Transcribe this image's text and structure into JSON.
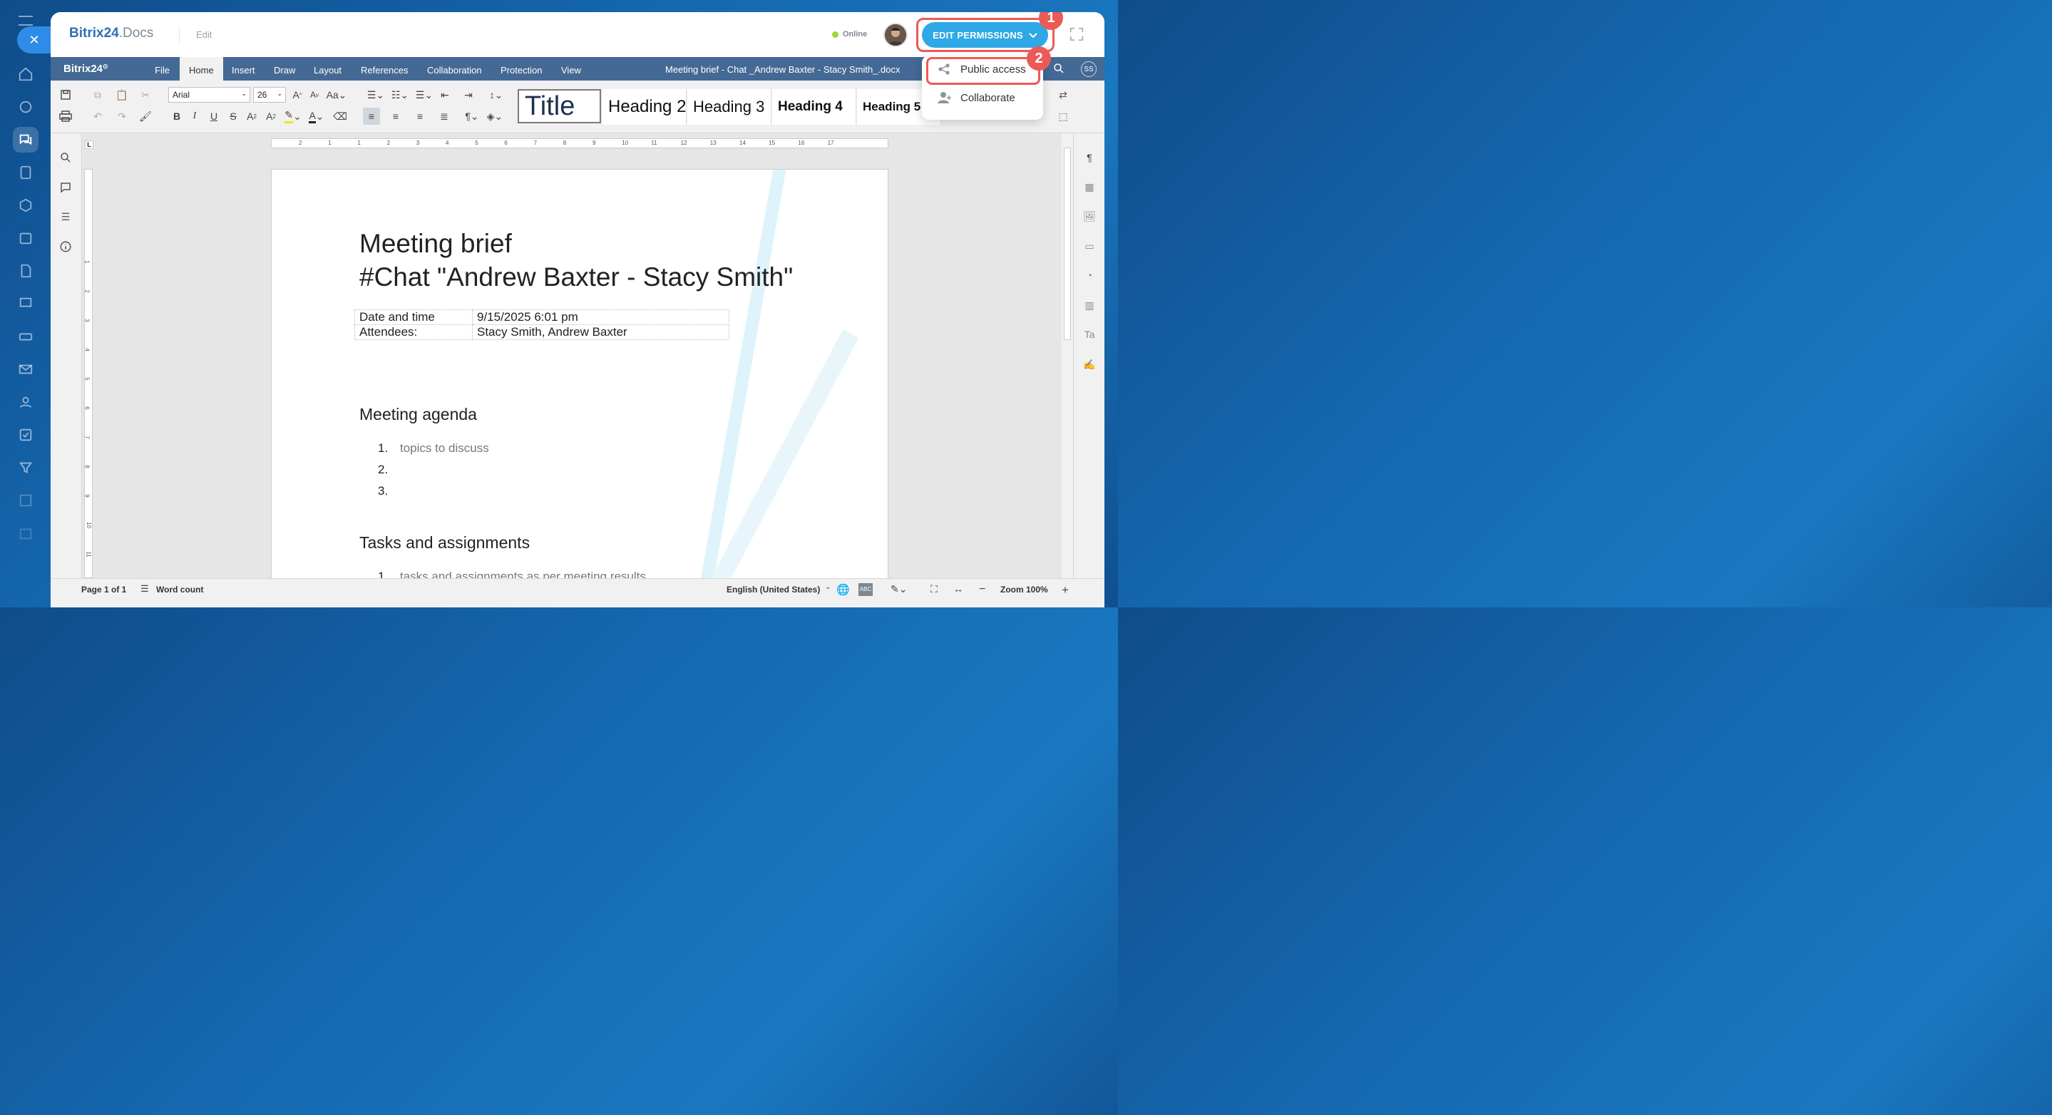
{
  "logo": {
    "brand": "Bitrix24",
    "suffix": ".Docs"
  },
  "mode_label": "Edit",
  "status": {
    "online": "Online"
  },
  "edit_permissions": {
    "label": "EDIT PERMISSIONS"
  },
  "badges": {
    "first": "1",
    "second": "2"
  },
  "dropdown": {
    "items": [
      {
        "label": "Public access",
        "icon": "share-icon"
      },
      {
        "label": "Collaborate",
        "icon": "add-user-icon"
      }
    ]
  },
  "app_name": "Bitrix24",
  "tabs": [
    "File",
    "Home",
    "Insert",
    "Draw",
    "Layout",
    "References",
    "Collaboration",
    "Protection",
    "View"
  ],
  "active_tab": "Home",
  "doc_title": "Meeting brief - Chat _Andrew Baxter - Stacy Smith_.docx",
  "user_initials": "SS",
  "font": {
    "family": "Arial",
    "size": "26"
  },
  "styles": [
    "Title",
    "Heading 2",
    "Heading 3",
    "Heading 4",
    "Heading 5"
  ],
  "ruler_labels": [
    "2",
    "1",
    "1",
    "2",
    "3",
    "4",
    "5",
    "6",
    "7",
    "8",
    "9",
    "10",
    "11",
    "12",
    "13",
    "14",
    "15",
    "16",
    "17"
  ],
  "document": {
    "title_line1": "Meeting brief",
    "title_line2": "#Chat \"Andrew Baxter - Stacy Smith\"",
    "table": [
      {
        "label": "Date and time",
        "value": "9/15/2025 6:01 pm"
      },
      {
        "label": "Attendees:",
        "value": "Stacy Smith, Andrew Baxter"
      }
    ],
    "agenda_heading": "Meeting agenda",
    "agenda_items": [
      {
        "num": "1.",
        "text": "topics to discuss"
      },
      {
        "num": "2.",
        "text": ""
      },
      {
        "num": "3.",
        "text": ""
      }
    ],
    "tasks_heading": "Tasks and assignments",
    "tasks_items": [
      {
        "num": "1.",
        "text": "tasks and assignments as per meeting results"
      }
    ]
  },
  "statusbar": {
    "page": "Page 1 of 1",
    "word_count": "Word count",
    "language": "English (United States)",
    "zoom": "Zoom 100%"
  },
  "colors": {
    "accent": "#2fa8e6",
    "ribbon": "#446995",
    "highlight": "#ec5a55"
  }
}
